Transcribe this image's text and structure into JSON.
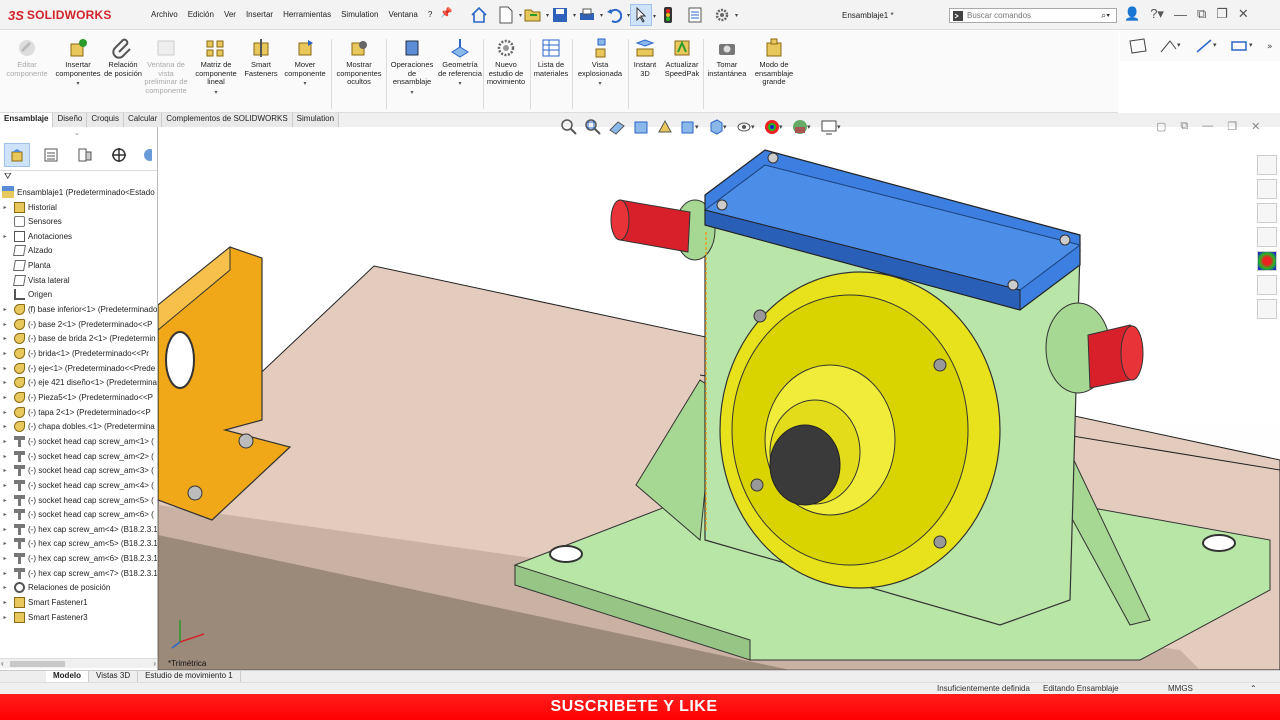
{
  "app": {
    "name": "SOLIDWORKS",
    "doc_title": "Ensamblaje1 *"
  },
  "menu": [
    "Archivo",
    "Edición",
    "Ver",
    "Insertar",
    "Herramientas",
    "Simulation",
    "Ventana",
    "?"
  ],
  "search": {
    "placeholder": "Buscar comandos"
  },
  "ribbon": {
    "buttons": [
      {
        "label": "Editar componente",
        "disabled": true
      },
      {
        "label": "Insertar componentes",
        "disabled": false
      },
      {
        "label": "Relación de posición",
        "disabled": false
      },
      {
        "label": "Ventana de vista preliminar de componente",
        "disabled": true
      },
      {
        "label": "Matriz de componente lineal",
        "disabled": false
      },
      {
        "label": "Smart Fasteners",
        "disabled": false
      },
      {
        "label": "Mover componente",
        "disabled": false
      },
      {
        "label": "Mostrar componentes ocultos",
        "disabled": false
      },
      {
        "label": "Operaciones de ensamblaje",
        "disabled": false
      },
      {
        "label": "Geometría de referencia",
        "disabled": false
      },
      {
        "label": "Nuevo estudio de movimiento",
        "disabled": false
      },
      {
        "label": "Lista de materiales",
        "disabled": false
      },
      {
        "label": "Vista explosionada",
        "disabled": false
      },
      {
        "label": "Instant 3D",
        "disabled": false
      },
      {
        "label": "Actualizar SpeedPak",
        "disabled": false
      },
      {
        "label": "Tomar instantánea",
        "disabled": false
      },
      {
        "label": "Modo de ensamblaje grande",
        "disabled": false
      }
    ]
  },
  "command_tabs": [
    "Ensamblaje",
    "Diseño",
    "Croquis",
    "Calcular",
    "Complementos de SOLIDWORKS",
    "Simulation"
  ],
  "active_command_tab": "Ensamblaje",
  "tree": {
    "root": "Ensamblaje1  (Predeterminado<Estado de",
    "items": [
      {
        "label": "Historial",
        "icon": "history-folder-icon",
        "expand": true
      },
      {
        "label": "Sensores",
        "icon": "sensor-icon",
        "expand": false
      },
      {
        "label": "Anotaciones",
        "icon": "annotation-icon",
        "expand": true
      },
      {
        "label": "Alzado",
        "icon": "plane-icon",
        "expand": false
      },
      {
        "label": "Planta",
        "icon": "plane-icon",
        "expand": false
      },
      {
        "label": "Vista lateral",
        "icon": "plane-icon",
        "expand": false
      },
      {
        "label": "Origen",
        "icon": "origin-icon",
        "expand": false
      },
      {
        "label": "(f) base inferior<1> (Predeterminado",
        "icon": "part-icon",
        "expand": true
      },
      {
        "label": "(-) base 2<1> (Predeterminado<<P",
        "icon": "part-icon",
        "expand": true
      },
      {
        "label": "(-) base de brida 2<1> (Predetermin",
        "icon": "part-icon",
        "expand": true
      },
      {
        "label": "(-) brida<1> (Predeterminado<<Pr",
        "icon": "part-icon",
        "expand": true
      },
      {
        "label": "(-) eje<1> (Predeterminado<<Prede",
        "icon": "part-icon",
        "expand": true
      },
      {
        "label": "(-) eje 421 diseño<1> (Predetermina",
        "icon": "part-icon",
        "expand": true
      },
      {
        "label": "(-) Pieza5<1> (Predeterminado<<P",
        "icon": "part-icon",
        "expand": true
      },
      {
        "label": "(-) tapa 2<1> (Predeterminado<<P",
        "icon": "part-icon",
        "expand": true
      },
      {
        "label": "(-) chapa dobles.<1> (Predetermina",
        "icon": "part-icon",
        "expand": true
      },
      {
        "label": "(-) socket head cap screw_am<1> (",
        "icon": "screw-icon",
        "expand": true
      },
      {
        "label": "(-) socket head cap screw_am<2> (",
        "icon": "screw-icon",
        "expand": true
      },
      {
        "label": "(-) socket head cap screw_am<3> (",
        "icon": "screw-icon",
        "expand": true
      },
      {
        "label": "(-) socket head cap screw_am<4> (",
        "icon": "screw-icon",
        "expand": true
      },
      {
        "label": "(-) socket head cap screw_am<5> (",
        "icon": "screw-icon",
        "expand": true
      },
      {
        "label": "(-) socket head cap screw_am<6> (",
        "icon": "screw-icon",
        "expand": true
      },
      {
        "label": "(-) hex cap screw_am<4> (B18.2.3.1",
        "icon": "screw-icon",
        "expand": true
      },
      {
        "label": "(-) hex cap screw_am<5> (B18.2.3.1",
        "icon": "screw-icon",
        "expand": true
      },
      {
        "label": "(-) hex cap screw_am<6> (B18.2.3.1",
        "icon": "screw-icon",
        "expand": true
      },
      {
        "label": "(-) hex cap screw_am<7> (B18.2.3.1",
        "icon": "screw-icon",
        "expand": true
      },
      {
        "label": "Relaciones de posición",
        "icon": "mate-icon",
        "expand": true
      },
      {
        "label": "Smart Fastener1",
        "icon": "fastener-icon",
        "expand": true
      },
      {
        "label": "Smart Fastener3",
        "icon": "fastener-icon",
        "expand": true
      }
    ]
  },
  "viewport": {
    "view_label": "*Trimétrica"
  },
  "bottom_tabs": [
    "Modelo",
    "Vistas 3D",
    "Estudio de movimiento 1"
  ],
  "active_bottom_tab": "Modelo",
  "status": {
    "definition": "Insuficientemente definida",
    "mode": "Editando Ensamblaje",
    "units": "MMGS"
  },
  "banner": {
    "text": "SUSCRIBETE Y LIKE"
  },
  "colors": {
    "brand_red": "#d2232a",
    "cover_blue": "#3c7fe0",
    "housing_green": "#b7e6a6",
    "flange_yellow": "#e7e21c",
    "bracket_orange": "#f0a818",
    "shaft_red": "#d8202a",
    "banner_red": "#ff0000"
  }
}
